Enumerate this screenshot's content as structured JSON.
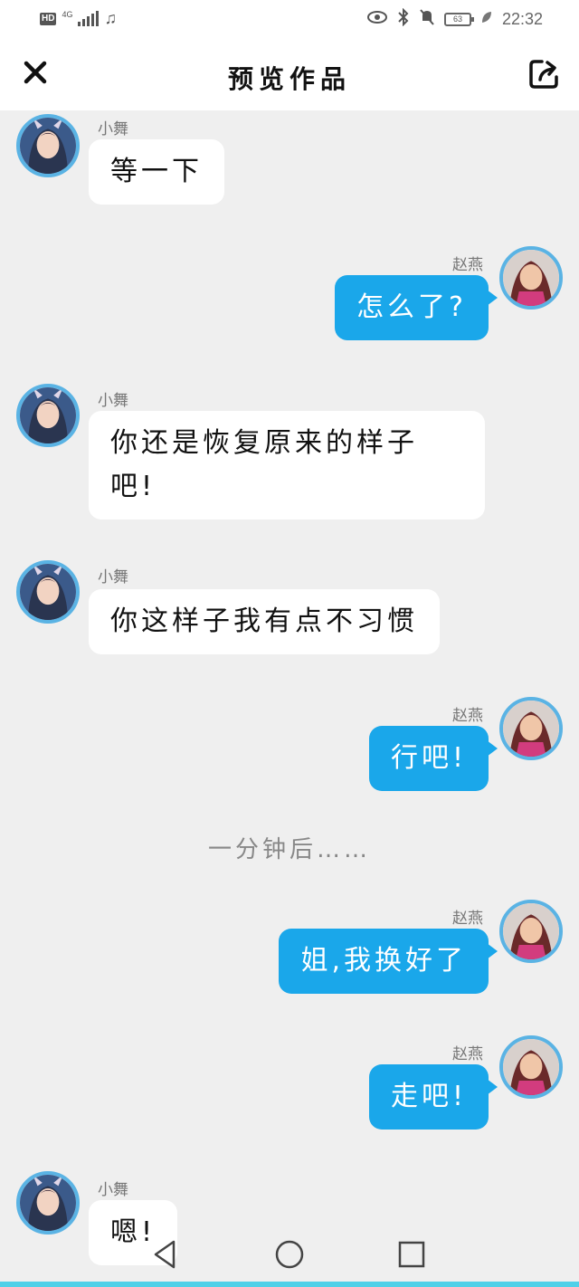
{
  "status_bar": {
    "hd": "HD",
    "network": "4G",
    "battery": "63",
    "time": "22:32"
  },
  "header": {
    "title": "预览作品",
    "close_icon": "close-icon",
    "share_icon": "share-icon"
  },
  "characters": {
    "left": {
      "name": "小舞",
      "avatar_color": "#3b5a8a"
    },
    "right": {
      "name": "赵燕",
      "avatar_color": "#b0487a"
    }
  },
  "messages": [
    {
      "side": "left",
      "name": "小舞",
      "lines": [
        "等一下"
      ]
    },
    {
      "side": "right",
      "name": "赵燕",
      "lines": [
        "怎么了?"
      ]
    },
    {
      "side": "left",
      "name": "小舞",
      "lines": [
        "你还是恢复原来的样子",
        "吧!"
      ]
    },
    {
      "side": "left",
      "name": "小舞",
      "lines": [
        "你这样子我有点不习惯"
      ]
    },
    {
      "side": "right",
      "name": "赵燕",
      "lines": [
        "行吧!"
      ]
    },
    {
      "side": "narration",
      "text": "一分钟后……"
    },
    {
      "side": "right",
      "name": "赵燕",
      "lines": [
        "姐,我换好了"
      ]
    },
    {
      "side": "right",
      "name": "赵燕",
      "lines": [
        "走吧!"
      ]
    },
    {
      "side": "left",
      "name": "小舞",
      "lines": [
        "嗯!"
      ]
    }
  ],
  "colors": {
    "bubble_right": "#1aa7ea",
    "bubble_left": "#ffffff",
    "avatar_ring": "#5ab3e4",
    "background": "#efefef"
  },
  "nav": {
    "back_icon": "back-triangle-icon",
    "home_icon": "home-circle-icon",
    "recents_icon": "recents-square-icon"
  }
}
